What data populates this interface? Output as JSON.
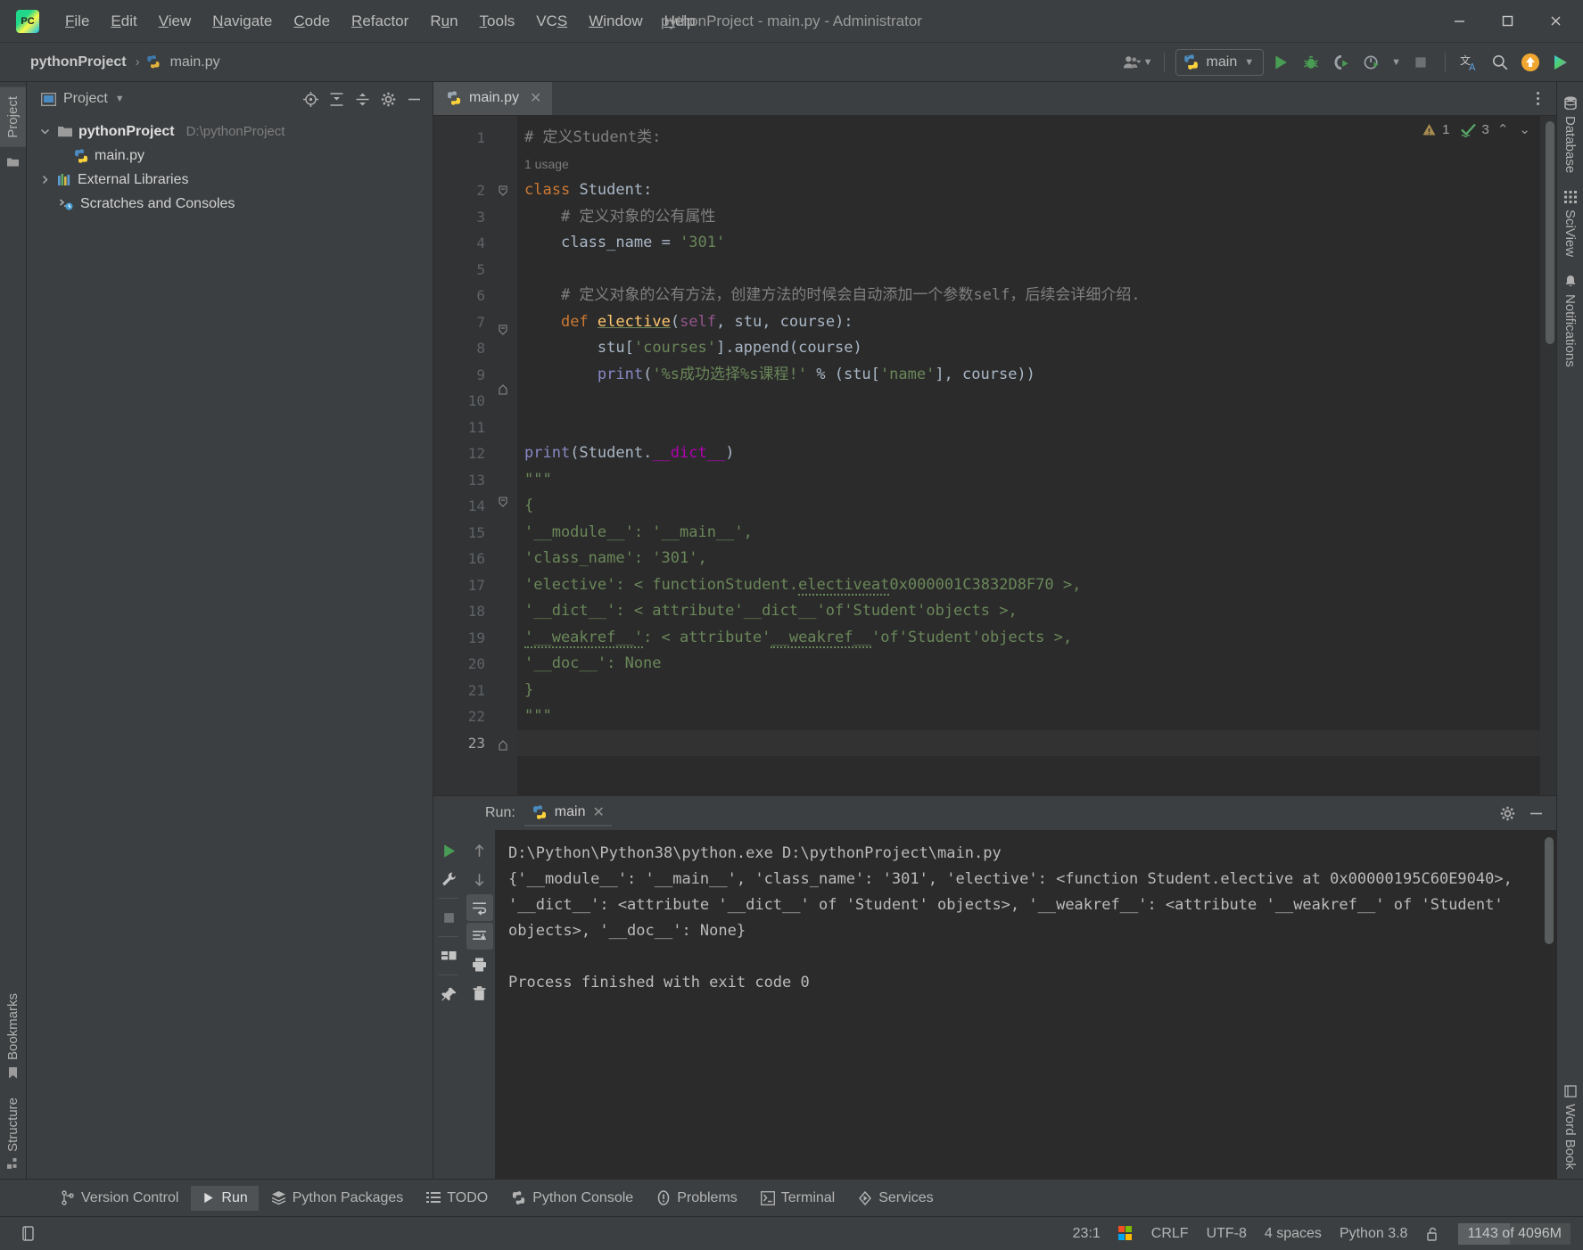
{
  "window": {
    "title": "pythonProject - main.py - Administrator",
    "logo_text": "PC",
    "minimize": "–",
    "maximize": "☐",
    "close": "✕"
  },
  "menu": [
    {
      "label": "File",
      "accel": "F"
    },
    {
      "label": "Edit",
      "accel": "E"
    },
    {
      "label": "View",
      "accel": "V"
    },
    {
      "label": "Navigate",
      "accel": "N"
    },
    {
      "label": "Code",
      "accel": "C"
    },
    {
      "label": "Refactor",
      "accel": "R"
    },
    {
      "label": "Run",
      "accel": "u"
    },
    {
      "label": "Tools",
      "accel": "T"
    },
    {
      "label": "VCS",
      "accel": "S"
    },
    {
      "label": "Window",
      "accel": "W"
    },
    {
      "label": "Help",
      "accel": "H"
    }
  ],
  "navbar": {
    "breadcrumb": [
      "pythonProject",
      "main.py"
    ],
    "separator": "›",
    "run_config": "main",
    "icons": [
      "user-avatar-icon",
      "python-icon",
      "run-icon",
      "debug-icon",
      "run-coverage-icon",
      "profile-icon",
      "stop-icon",
      "translate-icon",
      "search-everywhere-icon",
      "update-icon",
      "ide-feature-icon"
    ]
  },
  "left_strip": {
    "project_tab": "Project",
    "bookmarks_tab": "Bookmarks",
    "structure_tab": "Structure"
  },
  "right_strip": {
    "database_tab": "Database",
    "sciview_tab": "SciView",
    "notifications_tab": "Notifications",
    "word_book_tab": "Word Book"
  },
  "project_panel": {
    "title": "Project",
    "actions": [
      "locate-icon",
      "expand-all-icon",
      "collapse-all-icon",
      "settings-icon",
      "hide-icon"
    ],
    "tree": [
      {
        "label": "pythonProject",
        "sub": "D:\\pythonProject",
        "depth": 0,
        "arrow": "⌄",
        "icon": "folder-icon",
        "bold": true
      },
      {
        "label": "main.py",
        "sub": "",
        "depth": 1,
        "arrow": "",
        "icon": "python-file-icon",
        "bold": false
      },
      {
        "label": "External Libraries",
        "sub": "",
        "depth": 0,
        "arrow": "›",
        "icon": "libraries-icon",
        "bold": false
      },
      {
        "label": "Scratches and Consoles",
        "sub": "",
        "depth": 0,
        "arrow": "",
        "icon": "scratches-icon",
        "bold": false
      }
    ]
  },
  "editor": {
    "tab_label": "main.py",
    "tab_close": "✕",
    "options_icon": "more-options-icon",
    "inspection": {
      "warning_count": "1",
      "check_count": "3",
      "up": "⌃",
      "down": "⌄"
    },
    "usage_hint": "1 usage",
    "current_line": 23,
    "lines": [
      {
        "n": 1,
        "html": "<span class=\"cmt\"># 定义Student类:</span>"
      },
      {
        "n": 2,
        "html": "<span class=\"kw\">class</span> <span class=\"plain\">Student</span><span class=\"plain\">:</span>",
        "fold": "start"
      },
      {
        "n": 3,
        "html": "    <span class=\"cmt\"># 定义对象的公有属性</span>"
      },
      {
        "n": 4,
        "html": "    <span class=\"plain\">class_name</span> <span class=\"plain\">=</span> <span class=\"str\">'301'</span>"
      },
      {
        "n": 5,
        "html": ""
      },
      {
        "n": 6,
        "html": "    <span class=\"cmt\"># 定义对象的公有方法，创建方法的时候会自动添加一个参数self，后续会详细介绍.</span>"
      },
      {
        "n": 7,
        "html": "    <span class=\"kw\">def</span> <span class=\"fn under\">elective</span><span class=\"plain\">(</span><span class=\"param\">self</span><span class=\"plain\">, stu, course):</span>",
        "fold": "start"
      },
      {
        "n": 8,
        "html": "        <span class=\"plain\">stu[</span><span class=\"str\">'courses'</span><span class=\"plain\">].append(course)</span>"
      },
      {
        "n": 9,
        "html": "        <span class=\"builtin\">print</span><span class=\"plain\">(</span><span class=\"str\">'%s成功选择%s课程!'</span> <span class=\"plain\">% (stu[</span><span class=\"str\">'name'</span><span class=\"plain\">], course))</span>",
        "fold": "end"
      },
      {
        "n": 10,
        "html": ""
      },
      {
        "n": 11,
        "html": ""
      },
      {
        "n": 12,
        "html": "<span class=\"builtin\">print</span><span class=\"plain\">(Student.</span><span class=\"magic\">__dict__</span><span class=\"plain\">)</span>"
      },
      {
        "n": 13,
        "html": "<span class=\"str\">\"\"\"</span>",
        "fold": "start"
      },
      {
        "n": 14,
        "html": "<span class=\"str\">{</span>"
      },
      {
        "n": 15,
        "html": "<span class=\"str\">'__module__': '__main__',</span>"
      },
      {
        "n": 16,
        "html": "<span class=\"str\">'class_name': '301',</span>"
      },
      {
        "n": 17,
        "html": "<span class=\"str\">'elective': &lt; functionStudent.</span><span class=\"str wavy\">electiveat</span><span class=\"str\">0x000001C3832D8F70 &gt;,</span>"
      },
      {
        "n": 18,
        "html": "<span class=\"str\">'__dict__': &lt; attribute'__dict__'of'Student'objects &gt;,</span>"
      },
      {
        "n": 19,
        "html": "<span class=\"str wavy\">'__weakref__'</span><span class=\"str\">: &lt; attribute'</span><span class=\"str wavy\">__weakref__</span><span class=\"str\">'of'Student'objects &gt;,</span>"
      },
      {
        "n": 20,
        "html": "<span class=\"str\">'__doc__': None</span>"
      },
      {
        "n": 21,
        "html": "<span class=\"str\">}</span>"
      },
      {
        "n": 22,
        "html": "<span class=\"str\">\"\"\"</span>",
        "fold": "end"
      },
      {
        "n": 23,
        "html": ""
      }
    ]
  },
  "run_panel": {
    "label": "Run:",
    "tab_label": "main",
    "tab_close": "✕",
    "settings_icon": "settings-icon",
    "hide_icon": "hide-icon",
    "side_buttons_left": [
      "rerun-icon",
      "wrench-icon",
      "stop-icon",
      "layout-icon",
      "pin-icon"
    ],
    "side_buttons_right": [
      "up-arrow-icon",
      "down-arrow-icon",
      "soft-wrap-icon",
      "scroll-to-end-icon",
      "print-icon",
      "trash-icon"
    ],
    "console": [
      "D:\\Python\\Python38\\python.exe D:\\pythonProject\\main.py",
      "{'__module__': '__main__', 'class_name': '301', 'elective': <function Student.elective at 0x00000195C60E9040>, '__dict__': <attribute '__dict__' of 'Student' objects>, '__weakref__': <attribute '__weakref__' of 'Student' objects>, '__doc__': None}",
      "",
      "Process finished with exit code 0"
    ]
  },
  "bottom_bar": [
    {
      "label": "Version Control",
      "icon": "branch-icon",
      "active": false
    },
    {
      "label": "Run",
      "icon": "run-icon",
      "active": true
    },
    {
      "label": "Python Packages",
      "icon": "packages-icon",
      "active": false
    },
    {
      "label": "TODO",
      "icon": "todo-icon",
      "active": false
    },
    {
      "label": "Python Console",
      "icon": "python-icon",
      "active": false
    },
    {
      "label": "Problems",
      "icon": "problems-icon",
      "active": false
    },
    {
      "label": "Terminal",
      "icon": "terminal-icon",
      "active": false
    },
    {
      "label": "Services",
      "icon": "services-icon",
      "active": false
    }
  ],
  "statusbar": {
    "left_icon": "event-log-icon",
    "caret": "23:1",
    "os_icon": "windows-icon",
    "line_separator": "CRLF",
    "encoding": "UTF-8",
    "indent": "4 spaces",
    "interpreter": "Python 3.8",
    "lock_icon": "unlocked-icon",
    "memory": "1143 of 4096M"
  },
  "colors": {
    "bg": "#3c3f41",
    "editor_bg": "#2b2b2b",
    "accent_green": "#499c54",
    "string_green": "#6a8759",
    "keyword_orange": "#cc7832",
    "function_yellow": "#ffc66d",
    "magic_purple": "#b200b2",
    "builtin_blue": "#8888c6"
  }
}
